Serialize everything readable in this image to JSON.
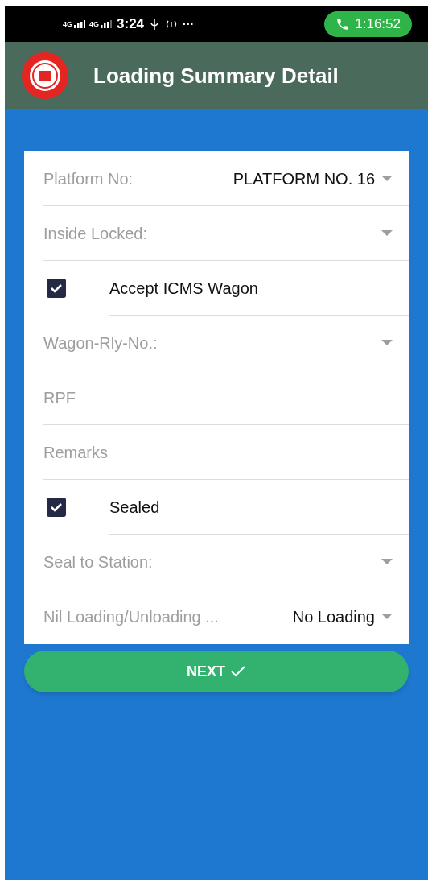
{
  "status_bar": {
    "network_1": "4G",
    "network_2": "4G",
    "time": "3:24",
    "more": "···",
    "call_timer": "1:16:52"
  },
  "header": {
    "title": "Loading Summary Detail"
  },
  "form": {
    "fields": [
      {
        "kind": "dropdown",
        "label": "Platform No:",
        "value": "PLATFORM NO. 16"
      },
      {
        "kind": "dropdown",
        "label": "Inside Locked:"
      },
      {
        "kind": "checkbox",
        "label": "Accept ICMS Wagon",
        "checked": true
      },
      {
        "kind": "dropdown",
        "label": "Wagon-Rly-No.:"
      },
      {
        "kind": "text",
        "placeholder": "RPF"
      },
      {
        "kind": "text",
        "placeholder": "Remarks"
      },
      {
        "kind": "checkbox",
        "label": "Sealed",
        "checked": true
      },
      {
        "kind": "dropdown",
        "label": "Seal to Station:"
      },
      {
        "kind": "dropdown",
        "label": "Nil Loading/Unloading ...",
        "value": "No Loading"
      }
    ]
  },
  "next_button": {
    "label": "NEXT"
  }
}
